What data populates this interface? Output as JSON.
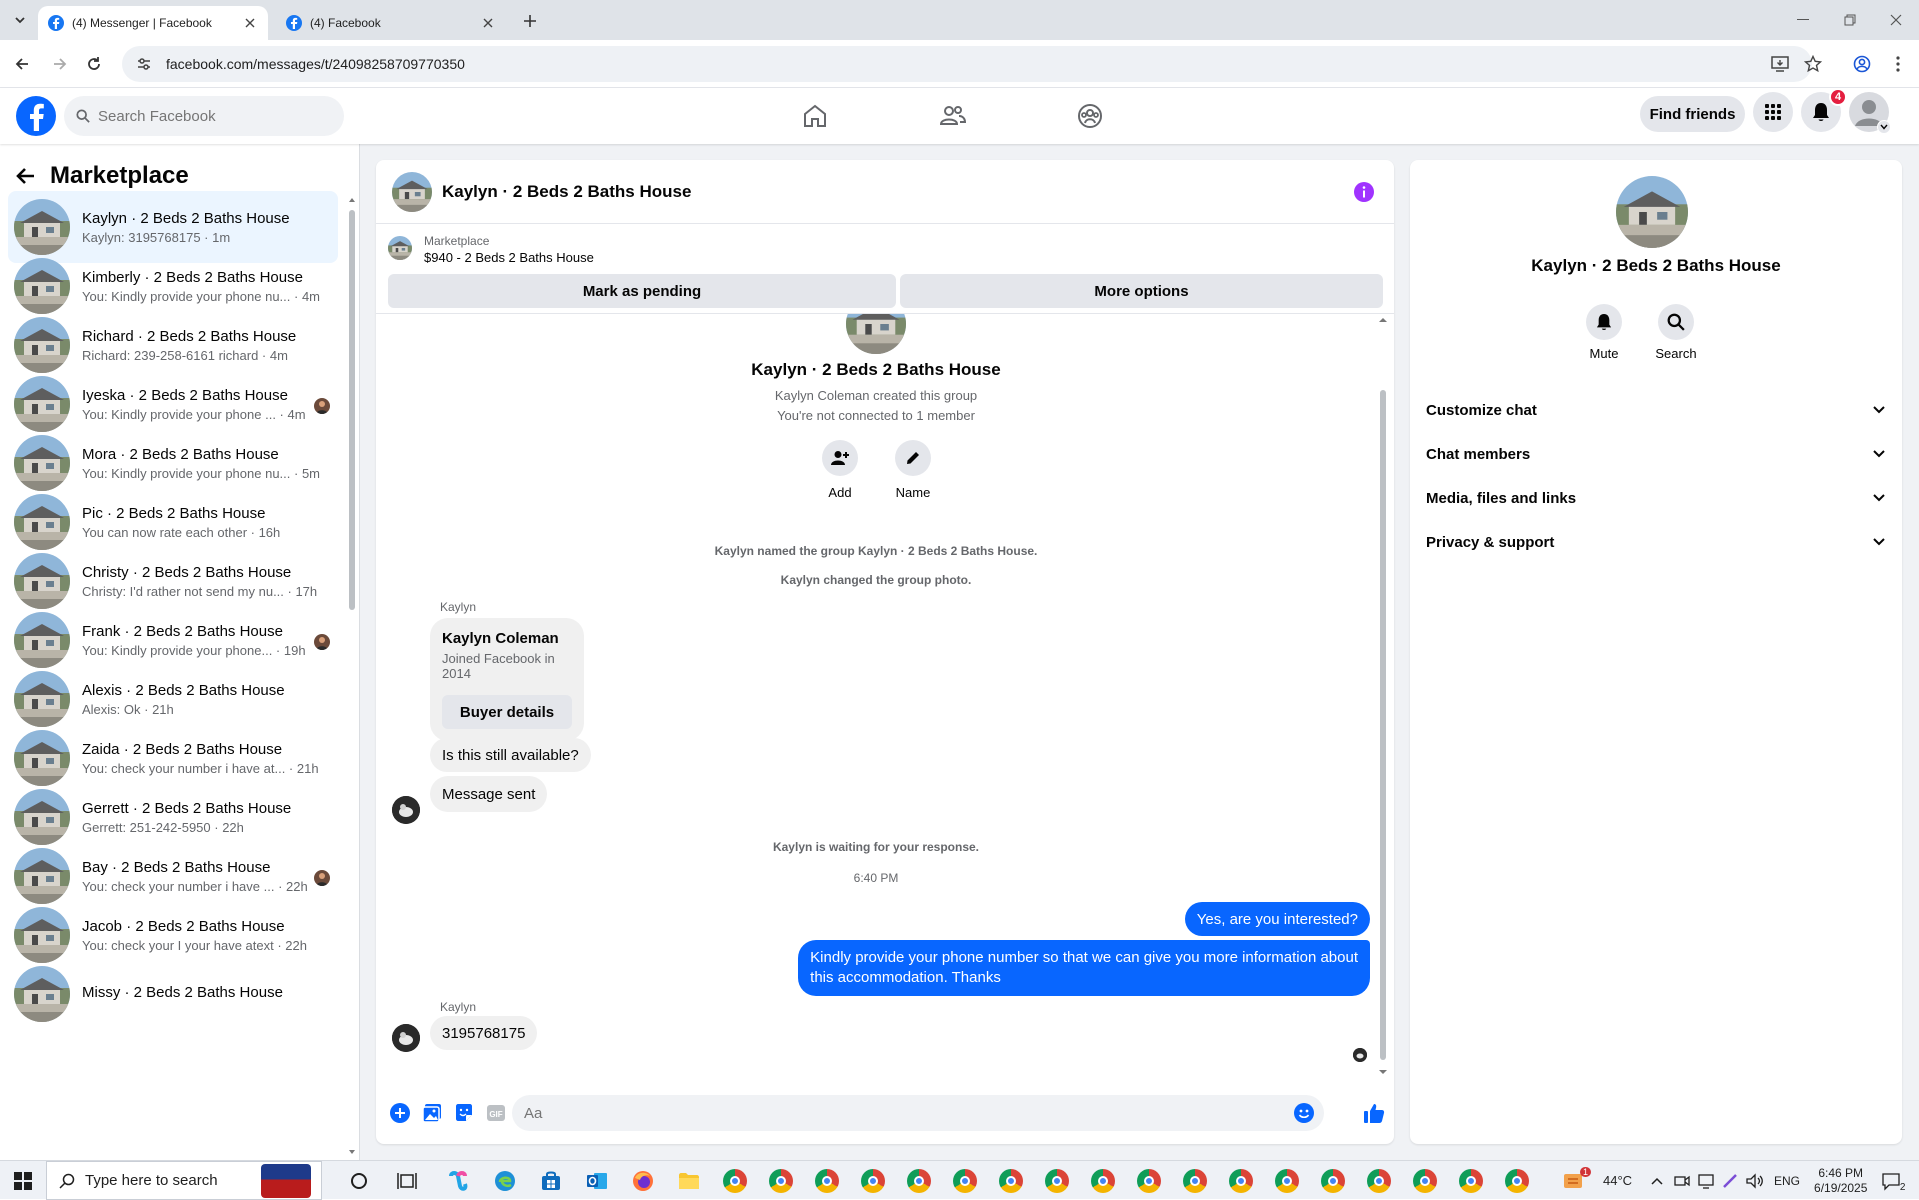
{
  "browser": {
    "tabs": [
      {
        "title": "(4) Messenger | Facebook",
        "active": true
      },
      {
        "title": "(4) Facebook",
        "active": false
      }
    ],
    "url": "facebook.com/messages/t/24098258709770350"
  },
  "header": {
    "search_placeholder": "Search Facebook",
    "find_friends": "Find friends",
    "notification_count": "4"
  },
  "sidebar": {
    "title": "Marketplace",
    "conversations": [
      {
        "name": "Kaylyn · 2 Beds 2 Baths House",
        "preview": "Kaylyn: 3195768175 · 1m",
        "active": true,
        "seen": false
      },
      {
        "name": "Kimberly · 2 Beds 2 Baths House",
        "preview": "You: Kindly provide your phone nu... · 4m",
        "seen": false
      },
      {
        "name": "Richard · 2 Beds 2 Baths House",
        "preview": "Richard: 239-258-6161 richard · 4m",
        "seen": false
      },
      {
        "name": "Iyeska · 2 Beds 2 Baths House",
        "preview": "You: Kindly provide your phone ... · 4m",
        "seen": true
      },
      {
        "name": "Mora · 2 Beds 2 Baths House",
        "preview": "You: Kindly provide your phone nu... · 5m",
        "seen": false
      },
      {
        "name": "Pic · 2 Beds 2 Baths House",
        "preview": "You can now rate each other · 16h",
        "seen": false
      },
      {
        "name": "Christy · 2 Beds 2 Baths House",
        "preview": "Christy: I'd rather not send my nu... · 17h",
        "seen": false
      },
      {
        "name": "Frank · 2 Beds 2 Baths House",
        "preview": "You: Kindly provide your phone... · 19h",
        "seen": true
      },
      {
        "name": "Alexis · 2 Beds 2 Baths House",
        "preview": "Alexis: Ok · 21h",
        "seen": false
      },
      {
        "name": "Zaida · 2 Beds 2 Baths House",
        "preview": "You: check your number i have at... · 21h",
        "seen": false
      },
      {
        "name": "Gerrett · 2 Beds 2 Baths House",
        "preview": "Gerrett: 251-242-5950 · 22h",
        "seen": false
      },
      {
        "name": "Bay · 2 Beds 2 Baths House",
        "preview": "You: check your number i have ... · 22h",
        "seen": true
      },
      {
        "name": "Jacob · 2 Beds 2 Baths House",
        "preview": "You: check your I your have atext · 22h",
        "seen": false
      },
      {
        "name": "Missy · 2 Beds 2 Baths House",
        "preview": "",
        "seen": false
      }
    ]
  },
  "chat": {
    "title": "Kaylyn · 2 Beds 2 Baths House",
    "marketplace_label": "Marketplace",
    "listing": "$940 - 2 Beds 2 Baths House",
    "mark_pending": "Mark as pending",
    "more_options": "More options",
    "group_name": "Kaylyn · 2 Beds 2 Baths House",
    "created_by": "Kaylyn Coleman created this group",
    "not_connected": "You're not connected to 1 member",
    "add_label": "Add",
    "name_label": "Name",
    "sys_named": "Kaylyn named the group Kaylyn · 2 Beds 2 Baths House.",
    "sys_photo": "Kaylyn changed the group photo.",
    "sender": "Kaylyn",
    "card_name": "Kaylyn Coleman",
    "card_joined": "Joined Facebook in 2014",
    "card_button": "Buyer details",
    "msg_available": "Is this still available?",
    "msg_sent": "Message sent",
    "waiting": "Kaylyn is waiting for your response.",
    "time": "6:40 PM",
    "me_1": "Yes, are you interested?",
    "me_2_line1": "Kindly provide your phone number so that we can give you more information about",
    "me_2_line2": "this accommodation. Thanks",
    "sender_2": "Kaylyn",
    "reply": "3195768175",
    "composer_placeholder": "Aa"
  },
  "details": {
    "name": "Kaylyn · 2 Beds 2 Baths House",
    "mute": "Mute",
    "search": "Search",
    "sections": [
      "Customize chat",
      "Chat members",
      "Media, files and links",
      "Privacy & support"
    ]
  },
  "taskbar": {
    "search_placeholder": "Type here to search",
    "temperature": "44°C",
    "language": "ENG",
    "time": "6:46 PM",
    "date": "6/19/2025",
    "notif_count": "2",
    "weather_badge": "1"
  },
  "colors": {
    "fb_blue": "#0866ff",
    "accent_purple": "#a033ff"
  }
}
